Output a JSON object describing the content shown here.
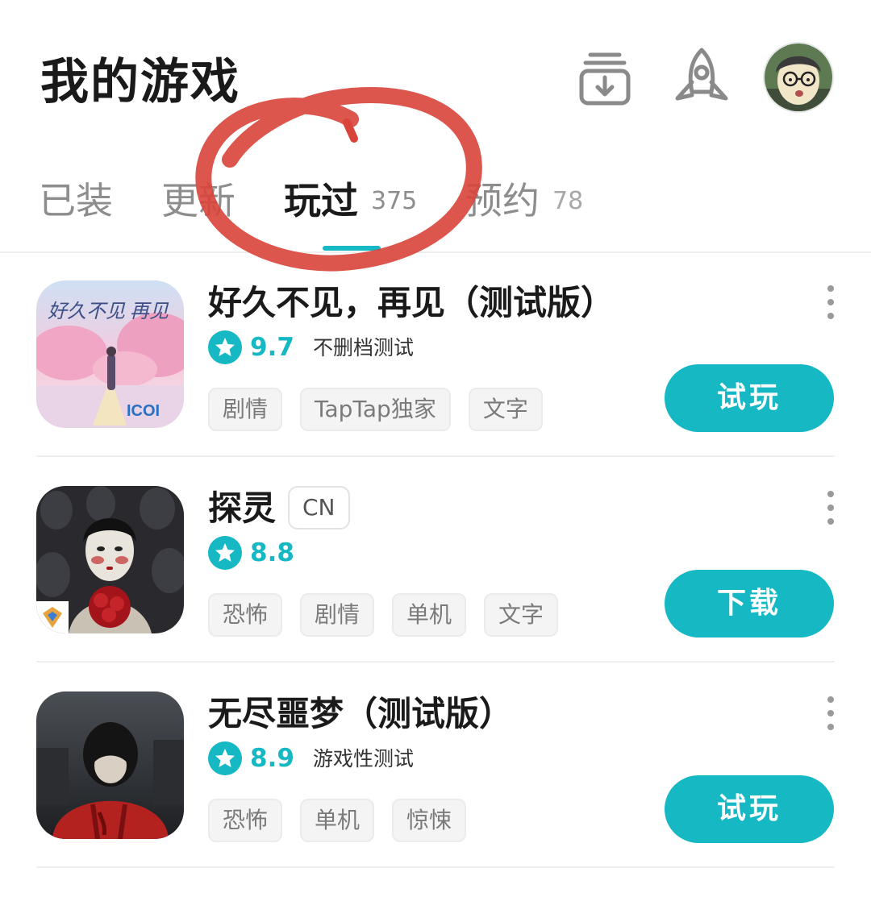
{
  "header": {
    "title": "我的游戏",
    "icons": [
      "download-manager-icon",
      "rocket-icon",
      "avatar"
    ]
  },
  "tabs": [
    {
      "label": "已装",
      "count": ""
    },
    {
      "label": "更新",
      "count": ""
    },
    {
      "label": "玩过",
      "count": "375",
      "active": true
    },
    {
      "label": "预约",
      "count": "78"
    }
  ],
  "games": [
    {
      "name": "好久不见，再见（测试版）",
      "badge": "",
      "rating": "9.7",
      "rating_note": "不删档测试",
      "tags": [
        "剧情",
        "TapTap独家",
        "文字"
      ],
      "action": "试玩",
      "icon_text": "好久不见 再见",
      "icon_brand": "ICOI"
    },
    {
      "name": "探灵",
      "badge": "CN",
      "rating": "8.8",
      "rating_note": "",
      "tags": [
        "恐怖",
        "剧情",
        "单机",
        "文字"
      ],
      "action": "下载"
    },
    {
      "name": "无尽噩梦（测试版）",
      "badge": "",
      "rating": "8.9",
      "rating_note": "游戏性测试",
      "tags": [
        "恐怖",
        "单机",
        "惊悚"
      ],
      "action": "试玩"
    }
  ],
  "colors": {
    "accent": "#16b8c4",
    "annotation_circle": "#d9443a",
    "text_primary": "#1a1a1a",
    "text_secondary": "#8d8d8d"
  }
}
